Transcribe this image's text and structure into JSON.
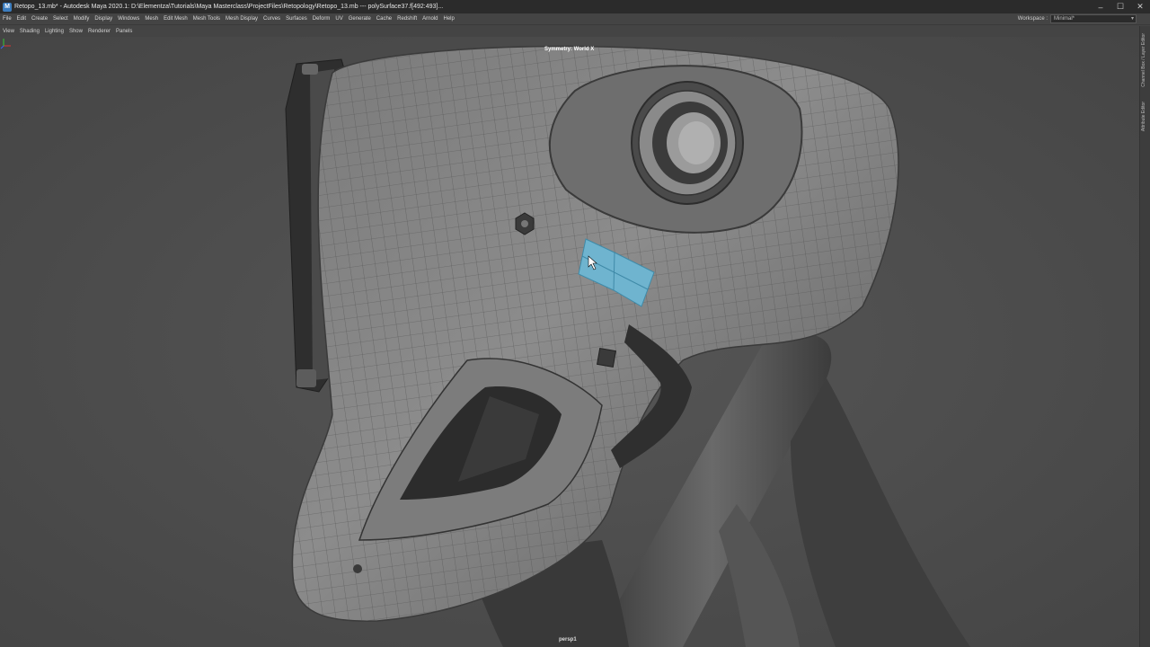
{
  "window": {
    "title": "Retopo_13.mb* - Autodesk Maya 2020.1: D:\\Elementza\\Tutorials\\Maya Masterclass\\ProjectFiles\\Retopology\\Retopo_13.mb   ---   polySurface37.f[492:493]...",
    "icon_label": "M",
    "minimize": "–",
    "maximize": "☐",
    "close": "✕"
  },
  "menubar": {
    "items": [
      "File",
      "Edit",
      "Create",
      "Select",
      "Modify",
      "Display",
      "Windows",
      "Mesh",
      "Edit Mesh",
      "Mesh Tools",
      "Mesh Display",
      "Curves",
      "Surfaces",
      "Deform",
      "UV",
      "Generate",
      "Cache",
      "Redshift",
      "Arnold",
      "Help"
    ],
    "workspace_label": "Workspace :",
    "workspace_value": "Minimal*"
  },
  "panel_menu": {
    "items": [
      "View",
      "Shading",
      "Lighting",
      "Show",
      "Renderer",
      "Panels"
    ]
  },
  "viewport": {
    "symmetry": "Symmetry: World X",
    "camera": "persp1",
    "background_color": "#4b4b4b",
    "selection_color": "#6fb4cf"
  },
  "side_tabs": {
    "channel_box": "Channel Box / Layer Editor",
    "attribute_editor": "Attribute Editor"
  },
  "icons": {
    "app": "maya-icon",
    "axis": "axis-gizmo-icon"
  }
}
